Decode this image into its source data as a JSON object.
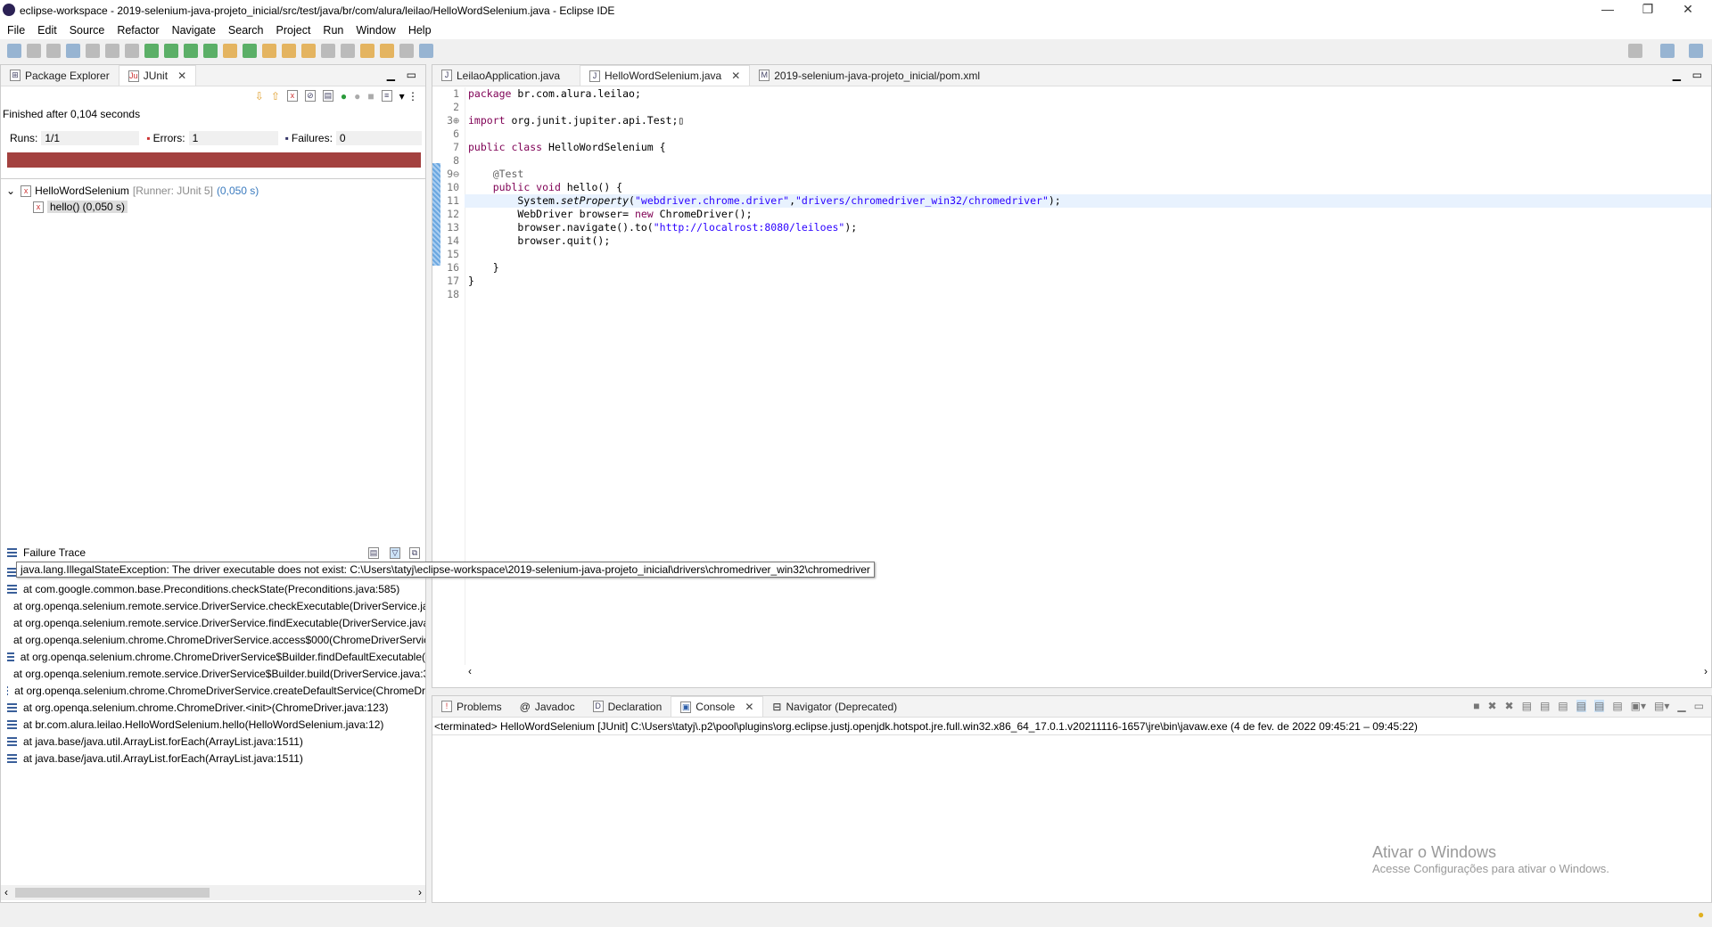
{
  "window": {
    "title": "eclipse-workspace - 2019-selenium-java-projeto_inicial/src/test/java/br/com/alura/leilao/HelloWordSelenium.java - Eclipse IDE",
    "min": "—",
    "max": "❐",
    "close": "✕"
  },
  "menu": [
    "File",
    "Edit",
    "Source",
    "Refactor",
    "Navigate",
    "Search",
    "Project",
    "Run",
    "Window",
    "Help"
  ],
  "left_panel": {
    "tabs": [
      {
        "label": "Package Explorer"
      },
      {
        "label": "JUnit",
        "active": true
      }
    ],
    "finished": "Finished after 0,104 seconds",
    "runs_label": "Runs:",
    "runs": "1/1",
    "errors_label": "Errors:",
    "errors": "1",
    "failures_label": "Failures:",
    "failures": "0",
    "progress": {
      "percent": 100,
      "color": "#a3413f"
    },
    "tree": {
      "root": "HelloWordSelenium",
      "runner": "[Runner: JUnit 5]",
      "root_time": "(0,050 s)",
      "child": "hello() (0,050 s)"
    },
    "failure_trace_title": "Failure Trace",
    "tooltip": "java.lang.IllegalStateException: The driver executable does not exist: C:\\Users\\tatyj\\eclipse-workspace\\2019-selenium-java-projeto_inicial\\drivers\\chromedriver_win32\\chromedriver",
    "trace": [
      "at com.google.common.base.Preconditions.checkState(Preconditions.java:585)",
      "at org.openqa.selenium.remote.service.DriverService.checkExecutable(DriverService.ja",
      "at org.openqa.selenium.remote.service.DriverService.findExecutable(DriverService.java",
      "at org.openqa.selenium.chrome.ChromeDriverService.access$000(ChromeDriverServic",
      "at org.openqa.selenium.chrome.ChromeDriverService$Builder.findDefaultExecutable(",
      "at org.openqa.selenium.remote.service.DriverService$Builder.build(DriverService.java:3",
      "at org.openqa.selenium.chrome.ChromeDriverService.createDefaultService(ChromeDr",
      "at org.openqa.selenium.chrome.ChromeDriver.<init>(ChromeDriver.java:123)",
      "at br.com.alura.leilao.HelloWordSelenium.hello(HelloWordSelenium.java:12)",
      "at java.base/java.util.ArrayList.forEach(ArrayList.java:1511)",
      "at java.base/java.util.ArrayList.forEach(ArrayList.java:1511)"
    ]
  },
  "editor": {
    "tabs": [
      {
        "label": "LeilaoApplication.java"
      },
      {
        "label": "HelloWordSelenium.java",
        "active": true
      },
      {
        "label": "2019-selenium-java-projeto_inicial/pom.xml"
      }
    ],
    "lines": [
      {
        "n": "1",
        "code": "<span class=kw>package</span> br.com.alura.leilao;"
      },
      {
        "n": "2",
        "code": ""
      },
      {
        "n": "3⊕",
        "code": "<span class=kw>import</span> org.junit.jupiter.api.Test;▯"
      },
      {
        "n": "6",
        "code": ""
      },
      {
        "n": "7",
        "code": "<span class=kw>public class</span> HelloWordSelenium {"
      },
      {
        "n": "8",
        "code": ""
      },
      {
        "n": "9⊖",
        "code": "    <span class=ann>@Test</span>"
      },
      {
        "n": "10",
        "code": "    <span class=kw>public void</span> hello() {"
      },
      {
        "n": "11",
        "code": "        System.<span class=it>setProperty</span>(<span class=str>\"webdriver.chrome.driver\"</span>,<span class=str>\"drivers/chromedriver_win32/chromedriver\"</span>);",
        "current": true
      },
      {
        "n": "12",
        "code": "        WebDriver browser= <span class=kw>new</span> ChromeDriver();"
      },
      {
        "n": "13",
        "code": "        browser.navigate().to(<span class=str>\"http://localrost:8080/leiloes\"</span>);"
      },
      {
        "n": "14",
        "code": "        browser.quit();"
      },
      {
        "n": "15",
        "code": ""
      },
      {
        "n": "16",
        "code": "    }"
      },
      {
        "n": "17",
        "code": "}"
      },
      {
        "n": "18",
        "code": ""
      }
    ]
  },
  "bottom_panel": {
    "tabs": [
      {
        "label": "Problems"
      },
      {
        "label": "Javadoc"
      },
      {
        "label": "Declaration"
      },
      {
        "label": "Console",
        "active": true
      },
      {
        "label": "Navigator (Deprecated)"
      }
    ],
    "console_header": "<terminated> HelloWordSelenium [JUnit] C:\\Users\\tatyj\\.p2\\pool\\plugins\\org.eclipse.justj.openjdk.hotspot.jre.full.win32.x86_64_17.0.1.v20211116-1657\\jre\\bin\\javaw.exe  (4 de fev. de 2022 09:45:21 – 09:45:22)"
  },
  "watermark": {
    "title": "Ativar o Windows",
    "subtitle": "Acesse Configurações para ativar o Windows."
  }
}
